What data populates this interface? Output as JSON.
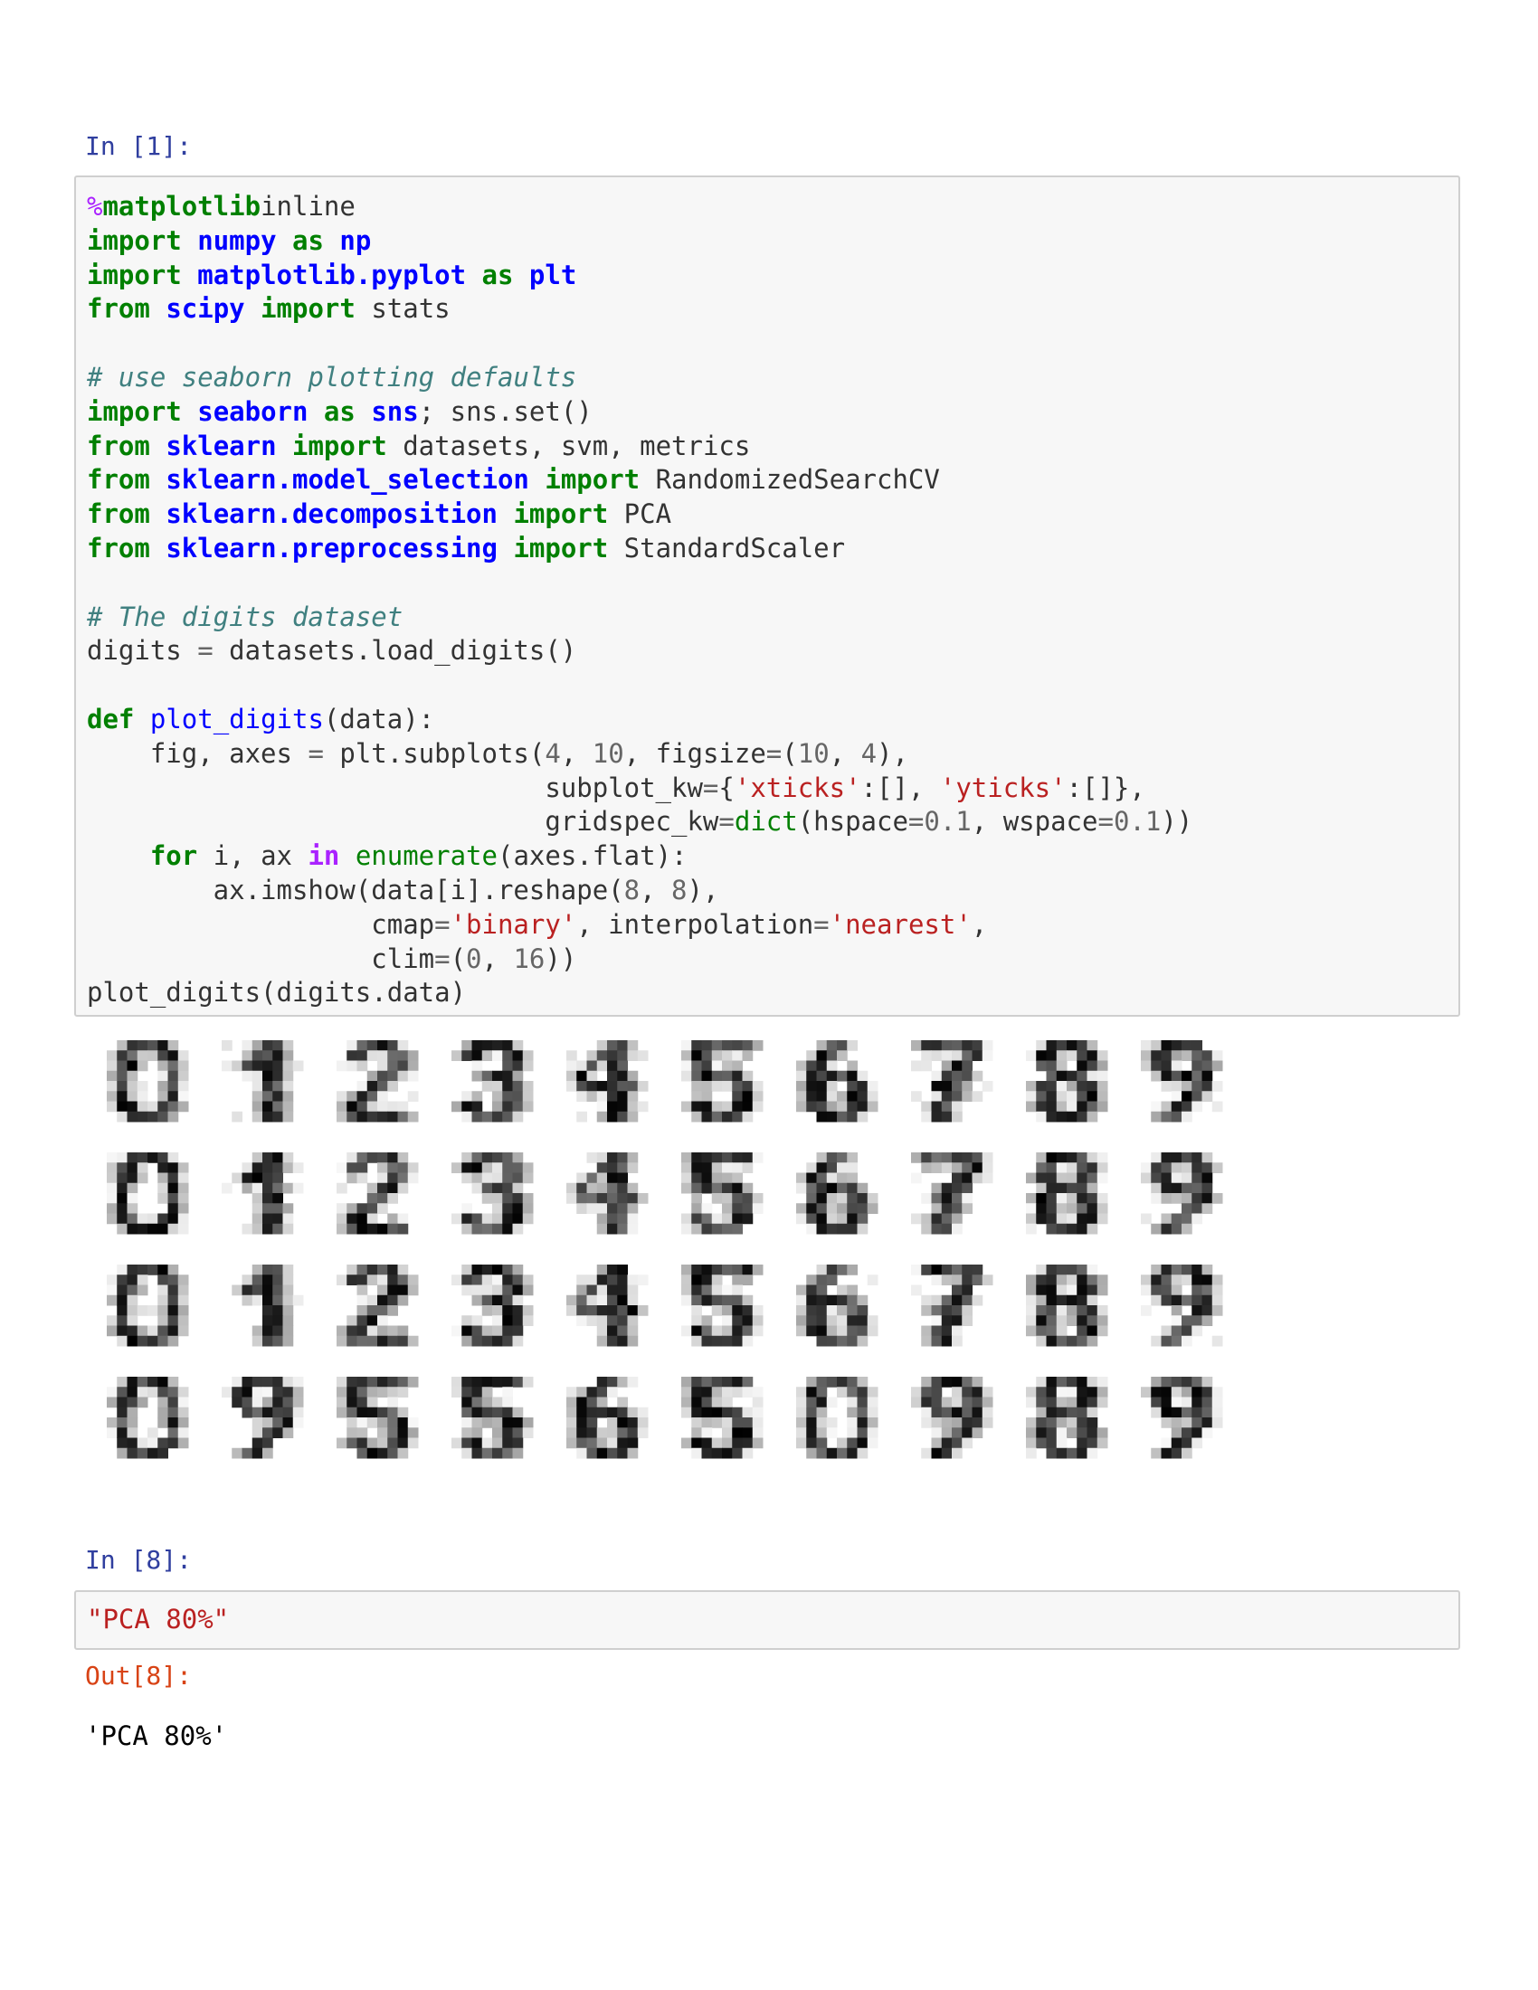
{
  "cells": [
    {
      "prompt": "In [1]:",
      "lines": [
        [
          [
            "mg",
            "%"
          ],
          [
            "kw",
            "matplotlib"
          ],
          [
            "",
            "inline"
          ]
        ],
        [
          [
            "kw",
            "import"
          ],
          [
            "",
            " "
          ],
          [
            "mod",
            "numpy"
          ],
          [
            "",
            " "
          ],
          [
            "kw",
            "as"
          ],
          [
            "",
            " "
          ],
          [
            "mod",
            "np"
          ]
        ],
        [
          [
            "kw",
            "import"
          ],
          [
            "",
            " "
          ],
          [
            "mod",
            "matplotlib.pyplot"
          ],
          [
            "",
            " "
          ],
          [
            "kw",
            "as"
          ],
          [
            "",
            " "
          ],
          [
            "mod",
            "plt"
          ]
        ],
        [
          [
            "kw",
            "from"
          ],
          [
            "",
            " "
          ],
          [
            "mod",
            "scipy"
          ],
          [
            "",
            " "
          ],
          [
            "kw",
            "import"
          ],
          [
            "",
            " stats"
          ]
        ],
        [],
        [
          [
            "cm",
            "# use seaborn plotting defaults"
          ]
        ],
        [
          [
            "kw",
            "import"
          ],
          [
            "",
            " "
          ],
          [
            "mod",
            "seaborn"
          ],
          [
            "",
            " "
          ],
          [
            "kw",
            "as"
          ],
          [
            "",
            " "
          ],
          [
            "mod",
            "sns"
          ],
          [
            "",
            "; sns.set()"
          ]
        ],
        [
          [
            "kw",
            "from"
          ],
          [
            "",
            " "
          ],
          [
            "mod",
            "sklearn"
          ],
          [
            "",
            " "
          ],
          [
            "kw",
            "import"
          ],
          [
            "",
            " datasets, svm, metrics"
          ]
        ],
        [
          [
            "kw",
            "from"
          ],
          [
            "",
            " "
          ],
          [
            "mod",
            "sklearn.model_selection"
          ],
          [
            "",
            " "
          ],
          [
            "kw",
            "import"
          ],
          [
            "",
            " RandomizedSearchCV"
          ]
        ],
        [
          [
            "kw",
            "from"
          ],
          [
            "",
            " "
          ],
          [
            "mod",
            "sklearn.decomposition"
          ],
          [
            "",
            " "
          ],
          [
            "kw",
            "import"
          ],
          [
            "",
            " PCA"
          ]
        ],
        [
          [
            "kw",
            "from"
          ],
          [
            "",
            " "
          ],
          [
            "mod",
            "sklearn.preprocessing"
          ],
          [
            "",
            " "
          ],
          [
            "kw",
            "import"
          ],
          [
            "",
            " StandardScaler"
          ]
        ],
        [],
        [
          [
            "cm",
            "# The digits dataset"
          ]
        ],
        [
          [
            "",
            "digits "
          ],
          [
            "eq",
            "="
          ],
          [
            "",
            " datasets.load_digits()"
          ]
        ],
        [],
        [
          [
            "kw",
            "def"
          ],
          [
            "",
            " "
          ],
          [
            "fn",
            "plot_digits"
          ],
          [
            "",
            "(data):"
          ]
        ],
        [
          [
            "",
            "    fig, axes "
          ],
          [
            "eq",
            "="
          ],
          [
            "",
            " plt.subplots("
          ],
          [
            "nm",
            "4"
          ],
          [
            "",
            ", "
          ],
          [
            "nm",
            "10"
          ],
          [
            "",
            ", figsize"
          ],
          [
            "eq",
            "="
          ],
          [
            "",
            "("
          ],
          [
            "nm",
            "10"
          ],
          [
            "",
            ", "
          ],
          [
            "nm",
            "4"
          ],
          [
            "",
            "),"
          ]
        ],
        [
          [
            "",
            "                             subplot_kw"
          ],
          [
            "eq",
            "="
          ],
          [
            "",
            "{"
          ],
          [
            "st",
            "'xticks'"
          ],
          [
            "",
            ":[], "
          ],
          [
            "st",
            "'yticks'"
          ],
          [
            "",
            ":[]},"
          ]
        ],
        [
          [
            "",
            "                             gridspec_kw"
          ],
          [
            "eq",
            "="
          ],
          [
            "bi",
            "dict"
          ],
          [
            "",
            "(hspace"
          ],
          [
            "eq",
            "="
          ],
          [
            "nm",
            "0.1"
          ],
          [
            "",
            ", wspace"
          ],
          [
            "eq",
            "="
          ],
          [
            "nm",
            "0.1"
          ],
          [
            "",
            "))"
          ]
        ],
        [
          [
            "",
            "    "
          ],
          [
            "kw",
            "for"
          ],
          [
            "",
            " i, ax "
          ],
          [
            "op",
            "in"
          ],
          [
            "",
            " "
          ],
          [
            "bi",
            "enumerate"
          ],
          [
            "",
            "(axes.flat):"
          ]
        ],
        [
          [
            "",
            "        ax.imshow(data[i].reshape("
          ],
          [
            "nm",
            "8"
          ],
          [
            "",
            ", "
          ],
          [
            "nm",
            "8"
          ],
          [
            "",
            "),"
          ]
        ],
        [
          [
            "",
            "                  cmap"
          ],
          [
            "eq",
            "="
          ],
          [
            "st",
            "'binary'"
          ],
          [
            "",
            ", interpolation"
          ],
          [
            "eq",
            "="
          ],
          [
            "st",
            "'nearest'"
          ],
          [
            "",
            ","
          ]
        ],
        [
          [
            "",
            "                  clim"
          ],
          [
            "eq",
            "="
          ],
          [
            "",
            "("
          ],
          [
            "nm",
            "0"
          ],
          [
            "",
            ", "
          ],
          [
            "nm",
            "16"
          ],
          [
            "",
            "))"
          ]
        ],
        [
          [
            "",
            "plot_digits(digits.data)"
          ]
        ]
      ]
    },
    {
      "prompt": "In [8]:",
      "lines": [
        [
          [
            "st",
            "\"PCA 80%\""
          ]
        ]
      ]
    }
  ],
  "output": {
    "prompt": "Out[8]:",
    "text": "'PCA 80%'"
  },
  "figure": {
    "rows": 4,
    "cols": 10,
    "cmap": "binary",
    "clim": [
      0,
      16
    ],
    "digits": [
      "0",
      "1",
      "2",
      "3",
      "4",
      "5",
      "6",
      "7",
      "8",
      "9",
      "0",
      "1",
      "2",
      "3",
      "4",
      "5",
      "6",
      "7",
      "8",
      "9",
      "0",
      "1",
      "2",
      "3",
      "4",
      "5",
      "6",
      "7",
      "8",
      "9",
      "0",
      "9",
      "5",
      "5",
      "6",
      "5",
      "0",
      "9",
      "8",
      "9"
    ]
  }
}
